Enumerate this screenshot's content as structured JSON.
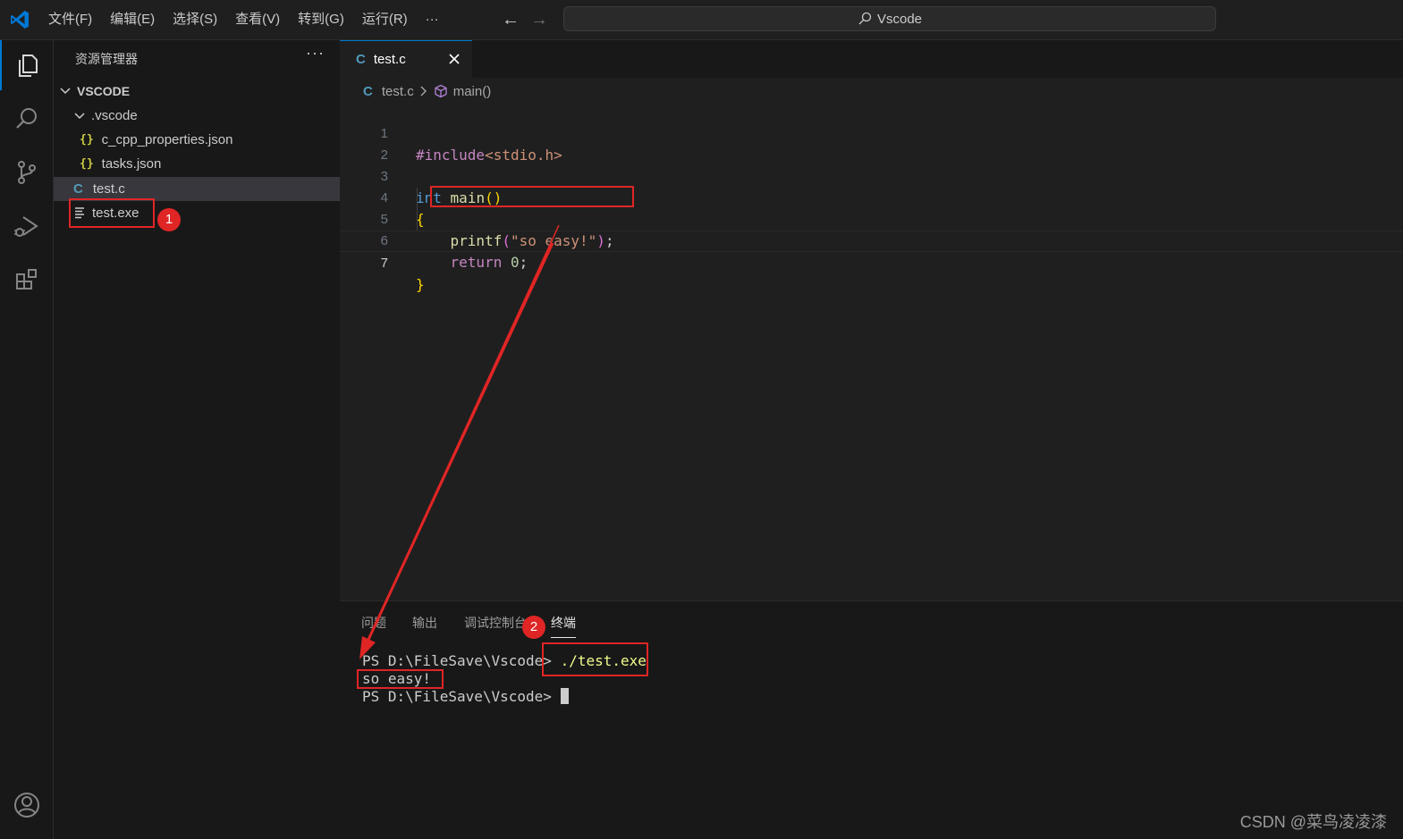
{
  "menu": [
    "文件(F)",
    "编辑(E)",
    "选择(S)",
    "查看(V)",
    "转到(G)",
    "运行(R)",
    "···"
  ],
  "search_label": "Vscode",
  "activity": [
    "explorer-icon",
    "search-icon",
    "source-control-icon",
    "run-debug-icon",
    "extensions-icon",
    "account-icon"
  ],
  "sidebar": {
    "title": "资源管理器",
    "more": "···",
    "root": "VSCODE",
    "items": [
      {
        "label": ".vscode",
        "type": "folder"
      },
      {
        "label": "c_cpp_properties.json",
        "type": "json",
        "icon": "{}"
      },
      {
        "label": "tasks.json",
        "type": "json",
        "icon": "{}"
      },
      {
        "label": "test.c",
        "type": "c",
        "icon": "C"
      },
      {
        "label": "test.exe",
        "type": "exe"
      }
    ]
  },
  "tab": {
    "icon": "C",
    "label": "test.c"
  },
  "breadcrumb": {
    "icon": "C",
    "file": "test.c",
    "symbol": "main()"
  },
  "code_lines": [
    "1",
    "2",
    "3",
    "4",
    "5",
    "6",
    "7"
  ],
  "code": {
    "l1_pp": "#include",
    "l1_inc": "<stdio.h>",
    "l3_kw": "int",
    "l3_fn": "main",
    "l3_par": "()",
    "l4": "{",
    "l5_fn": "printf",
    "l5_open": "(",
    "l5_str": "\"so easy!\"",
    "l5_close": ")",
    "l5_semi": ";",
    "l6_kw": "return",
    "l6_num": "0",
    "l6_semi": ";",
    "l7": "}"
  },
  "panel_tabs": [
    "问题",
    "输出",
    "调试控制台",
    "终端"
  ],
  "terminal": {
    "prompt1": "PS D:\\FileSave\\Vscode>",
    "cmd": "./test.exe",
    "output": "so easy!",
    "prompt2": "PS D:\\FileSave\\Vscode>"
  },
  "badges": [
    "1",
    "2"
  ],
  "watermark": "CSDN @菜鸟凌凌漆",
  "colors": {
    "accent": "#0078d4",
    "annotation": "#e02525"
  }
}
